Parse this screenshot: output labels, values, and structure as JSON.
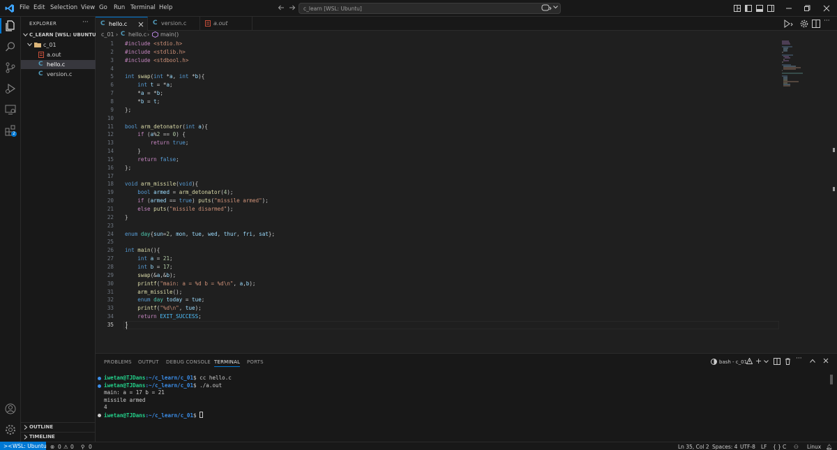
{
  "menu": [
    "File",
    "Edit",
    "Selection",
    "View",
    "Go",
    "Run",
    "Terminal",
    "Help"
  ],
  "search": {
    "text": "c_learn [WSL: Ubuntu]"
  },
  "sidebar": {
    "header": "EXPLORER",
    "workspace": "C_LEARN [WSL: UBUNTU]",
    "folder": "c_01",
    "files": [
      "a.out",
      "hello.c",
      "version.c"
    ],
    "outline": "OUTLINE",
    "timeline": "TIMELINE"
  },
  "tabs": [
    {
      "label": "hello.c",
      "icon": "C"
    },
    {
      "label": "version.c",
      "icon": "C"
    },
    {
      "label": "a.out",
      "icon": "binary"
    }
  ],
  "breadcrumb": {
    "folder": "c_01",
    "file": "hello.c",
    "symbol": "main()"
  },
  "code": [
    "#include <stdio.h>",
    "#include <stdlib.h>",
    "#include <stdbool.h>",
    "",
    "int swap(int *a, int *b){",
    "    int t = *a;",
    "    *a = *b;",
    "    *b = t;",
    "};",
    "",
    "bool arm_detonator(int a){",
    "    if (a%2 == 0) {",
    "        return true;",
    "    }",
    "    return false;",
    "};",
    "",
    "void arm_missile(void){",
    "    bool armed = arm_detonator(4);",
    "    if (armed == true) puts(\"missile armed\");",
    "    else puts(\"missile disarmed\");",
    "}",
    "",
    "enum day{sun=2, mon, tue, wed, thur, fri, sat};",
    "",
    "int main(){",
    "    int a = 21;",
    "    int b = 17;",
    "    swap(&a,&b);",
    "    printf(\"main: a = %d b = %d\\n\", a,b);",
    "    arm_missile();",
    "    enum day today = tue;",
    "    printf(\"%d\\n\", tue);",
    "    return EXIT_SUCCESS;",
    "}"
  ],
  "current_line": 35,
  "panel": {
    "tabs": [
      "PROBLEMS",
      "OUTPUT",
      "DEBUG CONSOLE",
      "TERMINAL",
      "PORTS"
    ],
    "active_tab": "TERMINAL",
    "shell": "bash - c_01",
    "terminal": [
      {
        "prompt_user": "iwetan@TJDans",
        "prompt_path": ":~/c_learn/c_01",
        "cmd": "$ cc hello.c"
      },
      {
        "prompt_user": "iwetan@TJDans",
        "prompt_path": ":~/c_learn/c_01",
        "cmd": "$ ./a.out"
      },
      {
        "output": "main: a = 17 b = 21"
      },
      {
        "output": "missile armed"
      },
      {
        "output": "4"
      },
      {
        "prompt_user": "iwetan@TJDans",
        "prompt_path": ":~/c_learn/c_01",
        "cmd": "$ "
      }
    ]
  },
  "status": {
    "remote": "WSL: Ubuntu",
    "errors": "0",
    "warnings": "0",
    "ports": "0",
    "position": "Ln 35, Col 2",
    "spaces": "Spaces: 4",
    "encoding": "UTF-8",
    "eol": "LF",
    "language": "C",
    "platform": "Linux"
  },
  "colors": {
    "accent": "#0078d4",
    "background": "#1f1f1f",
    "panel": "#181818"
  }
}
